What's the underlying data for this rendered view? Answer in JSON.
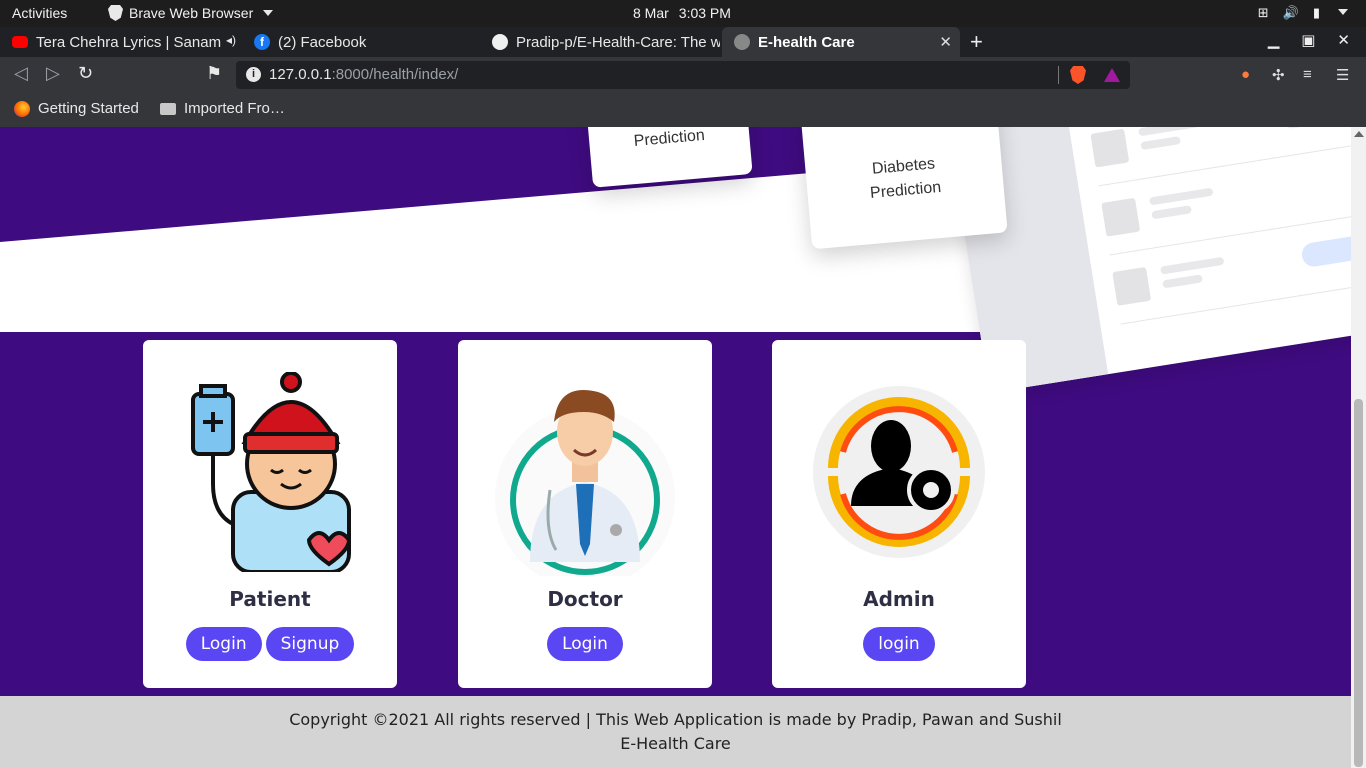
{
  "system": {
    "activities": "Activities",
    "app_name": "Brave Web Browser",
    "date": "8 Mar",
    "time": "3:03 PM"
  },
  "tabs": [
    {
      "label": "Tera Chehra Lyrics | Sanam",
      "icon": "youtube-icon",
      "color": "#ff0000"
    },
    {
      "label": "(2) Facebook",
      "icon": "facebook-icon",
      "color": "#1877f2"
    },
    {
      "label": "Pradip-p/E-Health-Care: The w",
      "icon": "github-icon",
      "color": "#f0f0f0"
    },
    {
      "label": "E-health Care",
      "icon": "globe-icon",
      "color": "#888888"
    }
  ],
  "address": {
    "host": "127.0.0.1",
    "path": ":8000/health/index/"
  },
  "bookmarks": [
    {
      "label": "Getting Started",
      "icon": "firefox-icon"
    },
    {
      "label": "Imported Fro…",
      "icon": "folder-icon"
    }
  ],
  "hero": {
    "card1": "Prediction",
    "card2_line1": "Diabetes",
    "card2_line2": "Prediction"
  },
  "cards": [
    {
      "title": "Patient",
      "buttons": [
        "Login",
        "Signup"
      ]
    },
    {
      "title": "Doctor",
      "buttons": [
        "Login"
      ]
    },
    {
      "title": "Admin",
      "buttons": [
        "login"
      ]
    }
  ],
  "footer": {
    "line1": "Copyright ©2021 All rights reserved | This Web Application is made by Pradip, Pawan and Sushil",
    "line2": "E-Health Care"
  },
  "colors": {
    "page_purple": "#3f0b80",
    "button": "#5a46f2",
    "footer_bg": "#d4d4d4"
  }
}
